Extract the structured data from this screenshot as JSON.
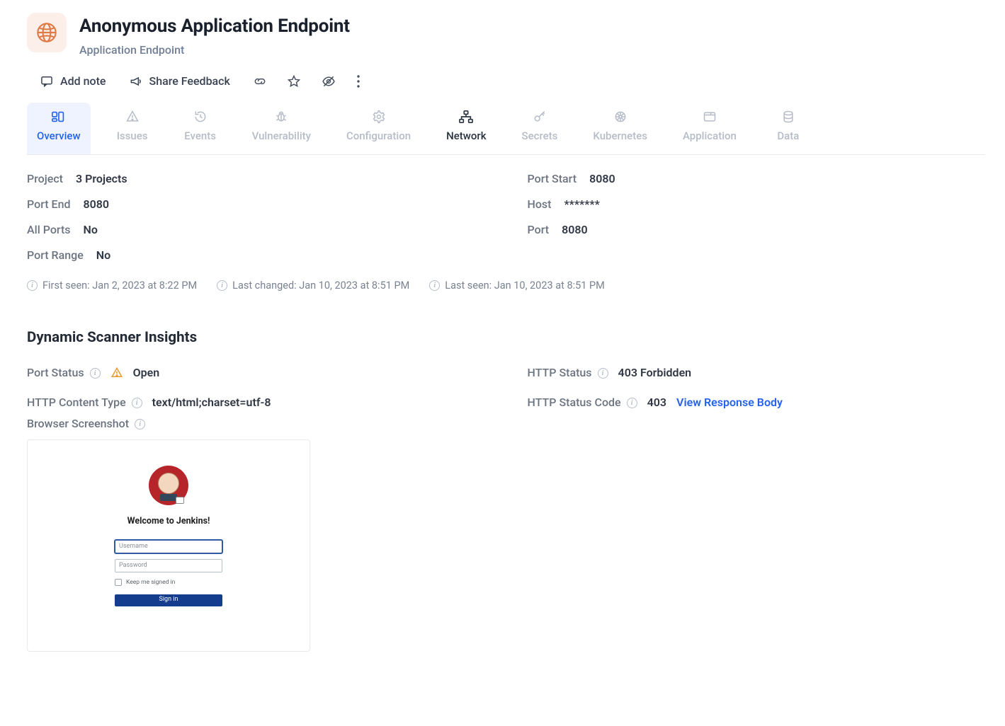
{
  "header": {
    "title": "Anonymous Application Endpoint",
    "subtitle": "Application Endpoint"
  },
  "toolbar": {
    "add_note": "Add note",
    "share_feedback": "Share Feedback"
  },
  "tabs": [
    {
      "key": "overview",
      "label": "Overview"
    },
    {
      "key": "issues",
      "label": "Issues"
    },
    {
      "key": "events",
      "label": "Events"
    },
    {
      "key": "vulnerability",
      "label": "Vulnerability"
    },
    {
      "key": "configuration",
      "label": "Configuration"
    },
    {
      "key": "network",
      "label": "Network"
    },
    {
      "key": "secrets",
      "label": "Secrets"
    },
    {
      "key": "kubernetes",
      "label": "Kubernetes"
    },
    {
      "key": "application",
      "label": "Application"
    },
    {
      "key": "data",
      "label": "Data"
    }
  ],
  "details": {
    "project_label": "Project",
    "project_value": "3 Projects",
    "port_start_label": "Port Start",
    "port_start_value": "8080",
    "port_end_label": "Port End",
    "port_end_value": "8080",
    "host_label": "Host",
    "host_value": "*******",
    "all_ports_label": "All Ports",
    "all_ports_value": "No",
    "port_label": "Port",
    "port_value": "8080",
    "port_range_label": "Port Range",
    "port_range_value": "No"
  },
  "timestamps": {
    "first_seen": "First seen: Jan 2, 2023 at 8:22 PM",
    "last_changed": "Last changed: Jan 10, 2023 at 8:51 PM",
    "last_seen": "Last seen: Jan 10, 2023 at 8:51 PM"
  },
  "insights": {
    "heading": "Dynamic Scanner Insights",
    "port_status_label": "Port Status",
    "port_status_value": "Open",
    "http_status_label": "HTTP Status",
    "http_status_value": "403 Forbidden",
    "http_content_type_label": "HTTP Content Type",
    "http_content_type_value": "text/html;charset=utf-8",
    "http_status_code_label": "HTTP Status Code",
    "http_status_code_value": "403",
    "view_response_body": "View Response Body",
    "browser_screenshot_label": "Browser Screenshot"
  },
  "screenshot": {
    "welcome": "Welcome to Jenkins!",
    "username_placeholder": "Username",
    "password_placeholder": "Password",
    "keep_signed_in": "Keep me signed in",
    "signin": "Sign in"
  }
}
